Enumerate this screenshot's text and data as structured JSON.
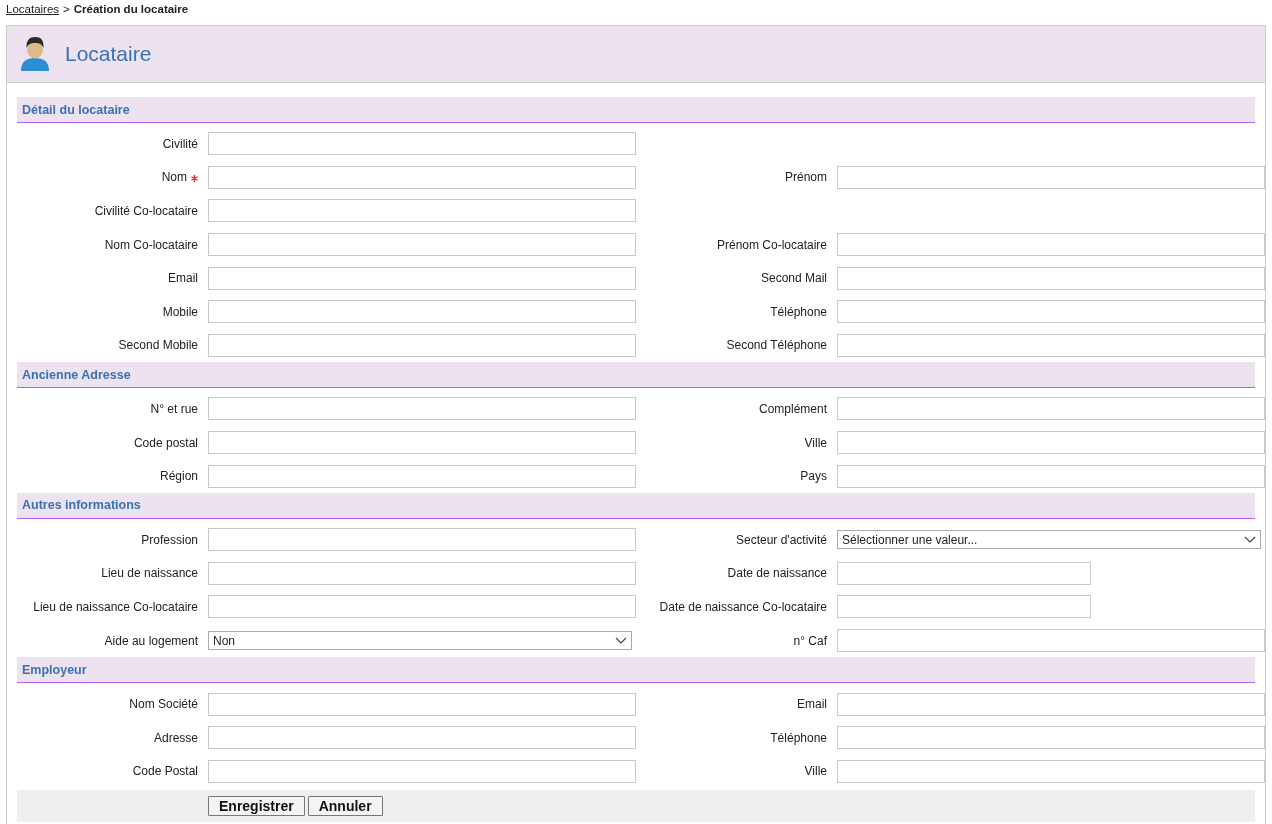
{
  "breadcrumb": {
    "link": "Locataires",
    "separator": ">",
    "current": "Création du locataire"
  },
  "header": {
    "title": "Locataire"
  },
  "sections": [
    {
      "title": "Détail du locataire",
      "rows": [
        {
          "left": {
            "label": "Civilité",
            "kind": "text",
            "required": false
          }
        },
        {
          "left": {
            "label": "Nom",
            "kind": "text",
            "required": true
          },
          "right": {
            "label": "Prénom",
            "kind": "text",
            "required": false
          }
        },
        {
          "left": {
            "label": "Civilité Co-locataire",
            "kind": "text",
            "required": false
          }
        },
        {
          "left": {
            "label": "Nom Co-locataire",
            "kind": "text",
            "required": false
          },
          "right": {
            "label": "Prénom Co-locataire",
            "kind": "text",
            "required": false
          }
        },
        {
          "left": {
            "label": "Email",
            "kind": "text",
            "required": false
          },
          "right": {
            "label": "Second Mail",
            "kind": "text",
            "required": false
          }
        },
        {
          "left": {
            "label": "Mobile",
            "kind": "text",
            "required": false
          },
          "right": {
            "label": "Téléphone",
            "kind": "text",
            "required": false
          }
        },
        {
          "left": {
            "label": "Second Mobile",
            "kind": "text",
            "required": false
          },
          "right": {
            "label": "Second Téléphone",
            "kind": "text",
            "required": false
          }
        }
      ]
    },
    {
      "title": "Ancienne Adresse",
      "rows": [
        {
          "left": {
            "label": "N° et rue",
            "kind": "text",
            "required": false
          },
          "right": {
            "label": "Complément",
            "kind": "text",
            "required": false
          }
        },
        {
          "left": {
            "label": "Code postal",
            "kind": "text",
            "required": false
          },
          "right": {
            "label": "Ville",
            "kind": "text",
            "required": false
          }
        },
        {
          "left": {
            "label": "Région",
            "kind": "text",
            "required": false
          },
          "right": {
            "label": "Pays",
            "kind": "text",
            "required": false
          }
        }
      ]
    },
    {
      "title": "Autres informations",
      "rows": [
        {
          "left": {
            "label": "Profession",
            "kind": "text",
            "required": false
          },
          "right": {
            "label": "Secteur d'activité",
            "kind": "select",
            "required": false,
            "value": "Sélectionner une valeur..."
          }
        },
        {
          "left": {
            "label": "Lieu de naissance",
            "kind": "text",
            "required": false
          },
          "right": {
            "label": "Date de naissance",
            "kind": "date",
            "required": false
          }
        },
        {
          "left": {
            "label": "Lieu de naissance Co-locataire",
            "kind": "text",
            "required": false
          },
          "right": {
            "label": "Date de naissance Co-locataire",
            "kind": "date",
            "required": false
          }
        },
        {
          "left": {
            "label": "Aide au logement",
            "kind": "select",
            "required": false,
            "value": "Non"
          },
          "right": {
            "label": "n° Caf",
            "kind": "text",
            "required": false
          }
        }
      ]
    },
    {
      "title": "Employeur",
      "rows": [
        {
          "left": {
            "label": "Nom Société",
            "kind": "text",
            "required": false
          },
          "right": {
            "label": "Email",
            "kind": "text",
            "required": false
          }
        },
        {
          "left": {
            "label": "Adresse",
            "kind": "text",
            "required": false
          },
          "right": {
            "label": "Téléphone",
            "kind": "text",
            "required": false
          }
        },
        {
          "left": {
            "label": "Code Postal",
            "kind": "text",
            "required": false
          },
          "right": {
            "label": "Ville",
            "kind": "text",
            "required": false
          }
        }
      ]
    }
  ],
  "buttons": [
    "Enregistrer",
    "Annuler"
  ]
}
